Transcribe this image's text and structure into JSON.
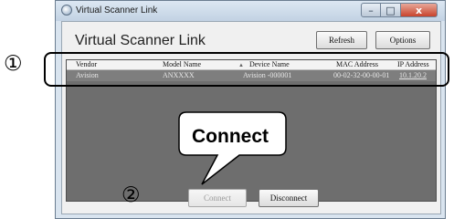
{
  "window": {
    "title": "Virtual Scanner Link",
    "controls": {
      "minimize": "–",
      "maximize": "□",
      "close": "x"
    }
  },
  "app": {
    "title": "Virtual Scanner Link",
    "refresh_label": "Refresh",
    "options_label": "Options"
  },
  "table": {
    "columns": [
      "Vendor",
      "Model Name",
      "Device Name",
      "MAC Address",
      "IP Address"
    ],
    "sorted_column": "Device Name",
    "sort_indicator": "▲",
    "rows": [
      {
        "vendor": "Avision",
        "model": "ANXXXX",
        "device": "Avision -000001",
        "mac": "00-02-32-00-00-01",
        "ip": "10.1.20.2"
      }
    ]
  },
  "footer": {
    "connect_label": "Connect",
    "disconnect_label": "Disconnect"
  },
  "annotations": {
    "marker_1": "①",
    "marker_2": "②",
    "callout_text": "Connect"
  }
}
